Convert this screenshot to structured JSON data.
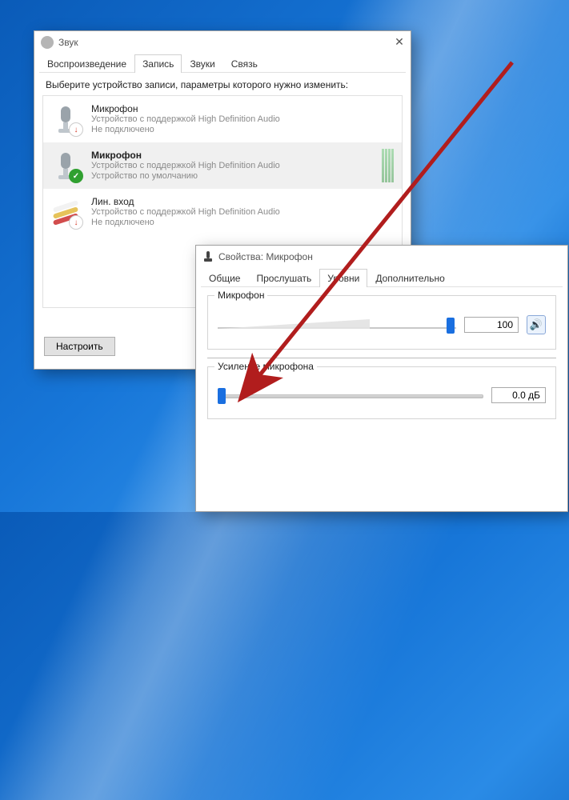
{
  "sound_window": {
    "title": "Звук",
    "tabs": {
      "play": "Воспроизведение",
      "record": "Запись",
      "sounds": "Звуки",
      "comm": "Связь"
    },
    "instruction": "Выберите устройство записи, параметры которого нужно изменить:",
    "devices": [
      {
        "name": "Микрофон",
        "desc": "Устройство с поддержкой High Definition Audio",
        "status": "Не подключено"
      },
      {
        "name": "Микрофон",
        "desc": "Устройство с поддержкой High Definition Audio",
        "status": "Устройство по умолчанию"
      },
      {
        "name": "Лин. вход",
        "desc": "Устройство с поддержкой High Definition Audio",
        "status": "Не подключено"
      }
    ],
    "configure": "Настроить"
  },
  "props_window": {
    "title": "Свойства: Микрофон",
    "tabs": {
      "general": "Общие",
      "listen": "Прослушать",
      "levels": "Уровни",
      "advanced": "Дополнительно"
    },
    "level": {
      "label": "Микрофон",
      "value": "100"
    },
    "boost": {
      "label": "Усиление микрофона",
      "value": "0.0 дБ"
    }
  }
}
